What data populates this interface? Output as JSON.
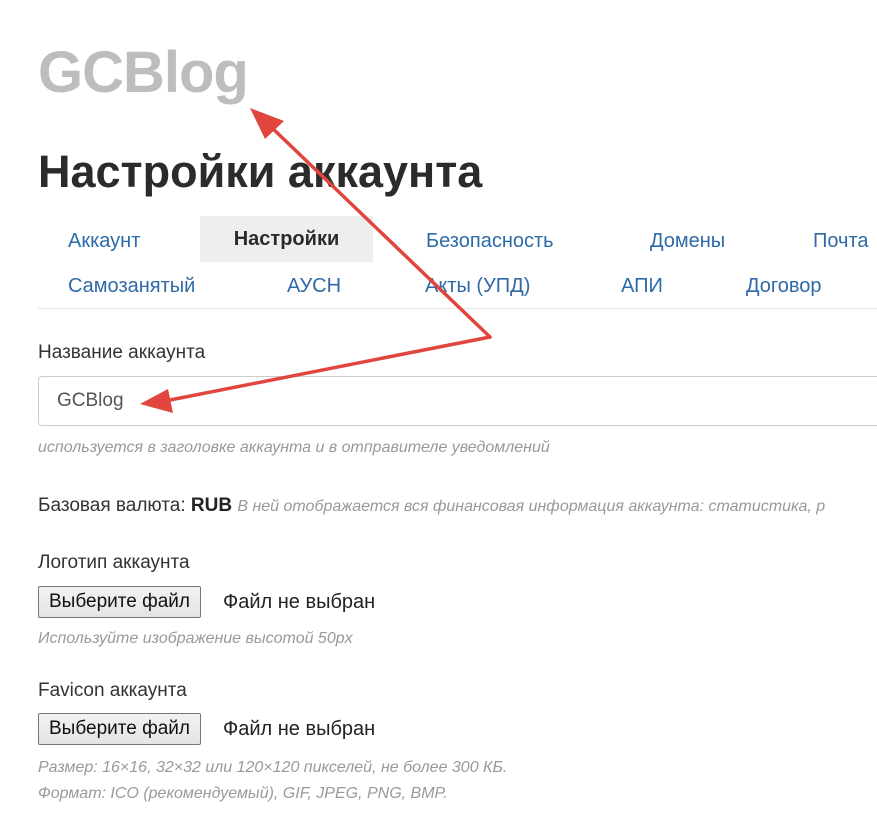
{
  "logo": {
    "text": "GCBlog"
  },
  "page_title": "Настройки аккаунта",
  "tabs": [
    {
      "label": "Аккаунт",
      "active": false
    },
    {
      "label": "Настройки",
      "active": true
    },
    {
      "label": "Безопасность",
      "active": false
    },
    {
      "label": "Домены",
      "active": false
    },
    {
      "label": "Почта",
      "active": false
    },
    {
      "label": "Самозанятый",
      "active": false
    },
    {
      "label": "АУСН",
      "active": false
    },
    {
      "label": "Акты (УПД)",
      "active": false
    },
    {
      "label": "АПИ",
      "active": false
    },
    {
      "label": "Договор",
      "active": false
    }
  ],
  "account_name": {
    "label": "Название аккаунта",
    "value": "GCBlog",
    "hint": "используется в заголовке аккаунта и в отправителе уведомлений"
  },
  "currency": {
    "label": "Базовая валюта:",
    "value": "RUB",
    "note": "В ней отображается вся финансовая информация аккаунта: статистика, р"
  },
  "logo_upload": {
    "label": "Логотип аккаунта",
    "button": "Выберите файл",
    "status": "Файл не выбран",
    "hint": "Используйте изображение высотой 50px"
  },
  "favicon_upload": {
    "label": "Favicon аккаунта",
    "button": "Выберите файл",
    "status": "Файл не выбран",
    "hint_line1": "Размер: 16×16, 32×32 или 120×120 пикселей, не более 300 КБ.",
    "hint_line2": "Формат: ICO (рекомендуемый), GIF, JPEG, PNG, BMP."
  },
  "colors": {
    "accent_link": "#2e6aa8",
    "arrow": "#e0463d",
    "logo_gray": "#bdbdbd"
  }
}
